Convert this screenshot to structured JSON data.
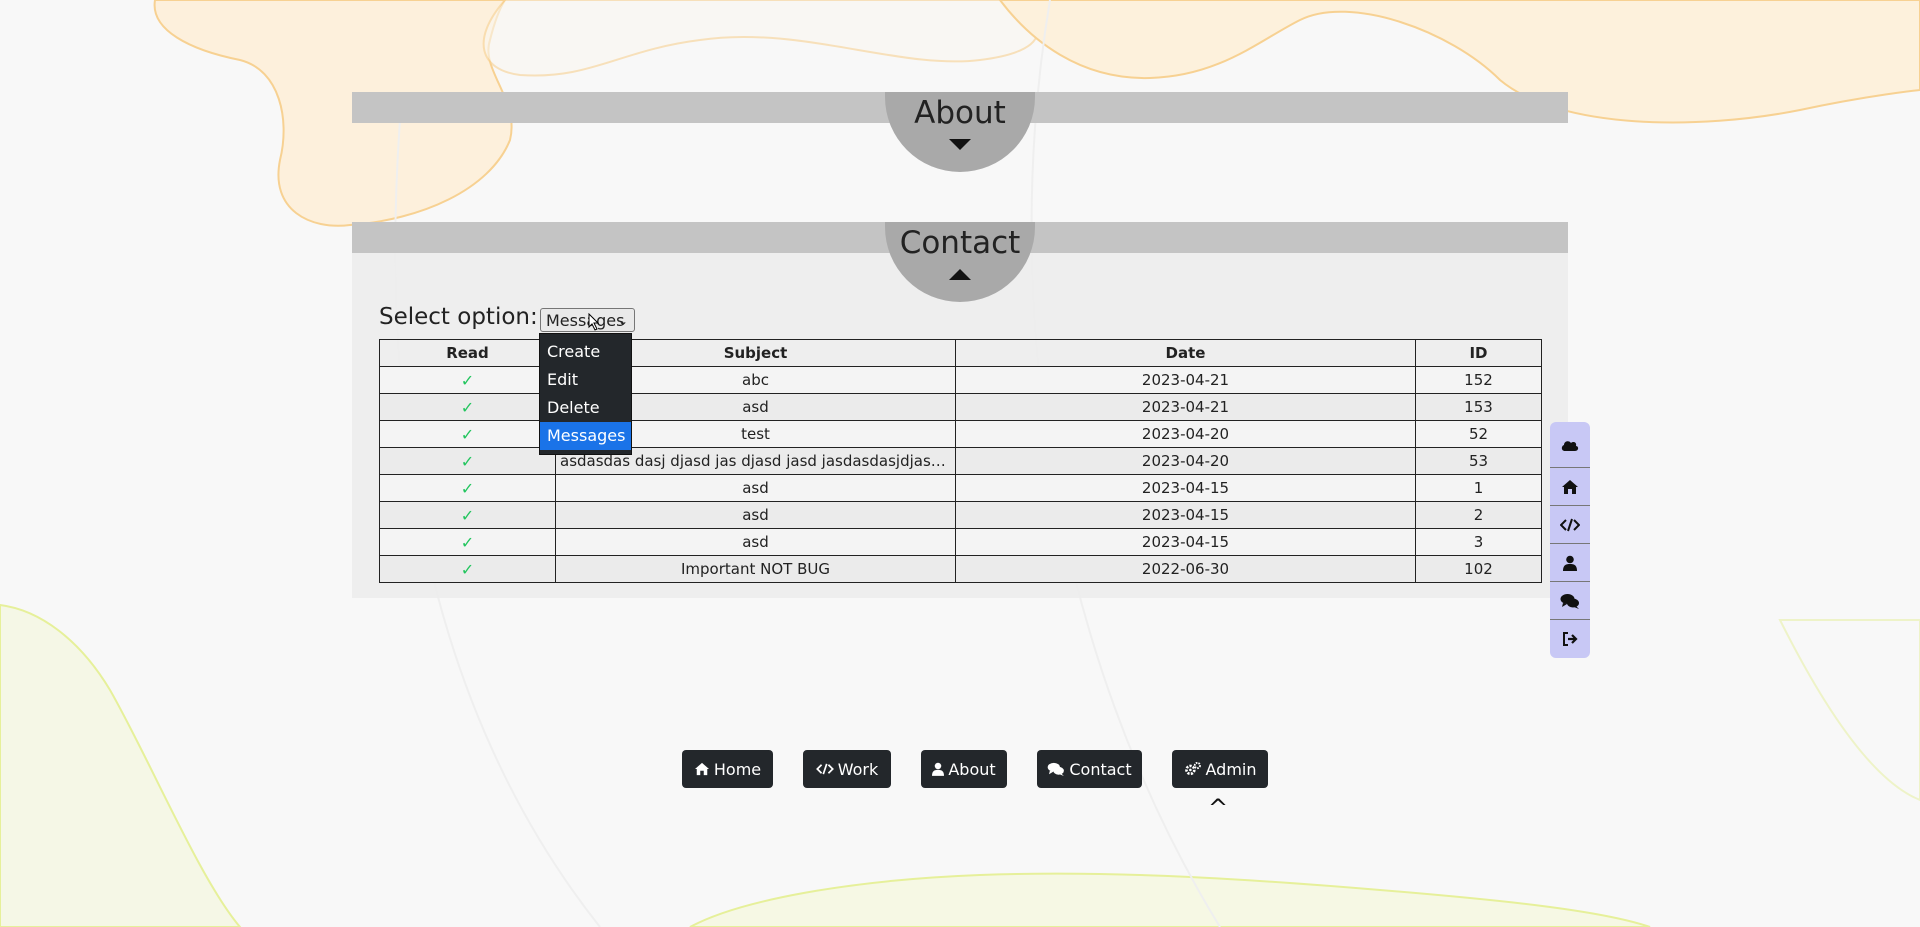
{
  "sections": {
    "about": {
      "title": "About"
    },
    "contact": {
      "title": "Contact"
    }
  },
  "select": {
    "label": "Select option:",
    "value": "Messages",
    "options": [
      "Create",
      "Edit",
      "Delete",
      "Messages"
    ],
    "selected_option": "Messages"
  },
  "table": {
    "headers": [
      "Read",
      "Subject",
      "Date",
      "ID"
    ],
    "rows": [
      {
        "read": "✓",
        "subject": "abc",
        "date": "2023-04-21",
        "id": "152"
      },
      {
        "read": "✓",
        "subject": "asd",
        "date": "2023-04-21",
        "id": "153"
      },
      {
        "read": "✓",
        "subject": "test",
        "date": "2023-04-20",
        "id": "52"
      },
      {
        "read": "✓",
        "subject": "asdasdas dasj djasd jas djasd jasd jasdasdasjdjasdjasdja sdjas …",
        "date": "2023-04-20",
        "id": "53"
      },
      {
        "read": "✓",
        "subject": "asd",
        "date": "2023-04-15",
        "id": "1"
      },
      {
        "read": "✓",
        "subject": "asd",
        "date": "2023-04-15",
        "id": "2"
      },
      {
        "read": "✓",
        "subject": "asd",
        "date": "2023-04-15",
        "id": "3"
      },
      {
        "read": "✓",
        "subject": "Important NOT BUG",
        "date": "2022-06-30",
        "id": "102"
      }
    ]
  },
  "side_nav": {
    "items": [
      {
        "icon": "cloud-icon"
      },
      {
        "icon": "home-icon"
      },
      {
        "icon": "code-icon"
      },
      {
        "icon": "user-icon"
      },
      {
        "icon": "comments-icon"
      },
      {
        "icon": "sign-out-icon"
      }
    ]
  },
  "bottom_nav": {
    "home": "Home",
    "work": "Work",
    "about": "About",
    "contact": "Contact",
    "admin": "Admin",
    "active_marker": "^"
  },
  "colors": {
    "bar": "#c4c4c4",
    "tab": "#a9a9a9",
    "button_bg": "#23272b",
    "sidenav_bg": "#c8c8f5",
    "check": "#22c55e",
    "dropdown_selected": "#1a73e8"
  }
}
